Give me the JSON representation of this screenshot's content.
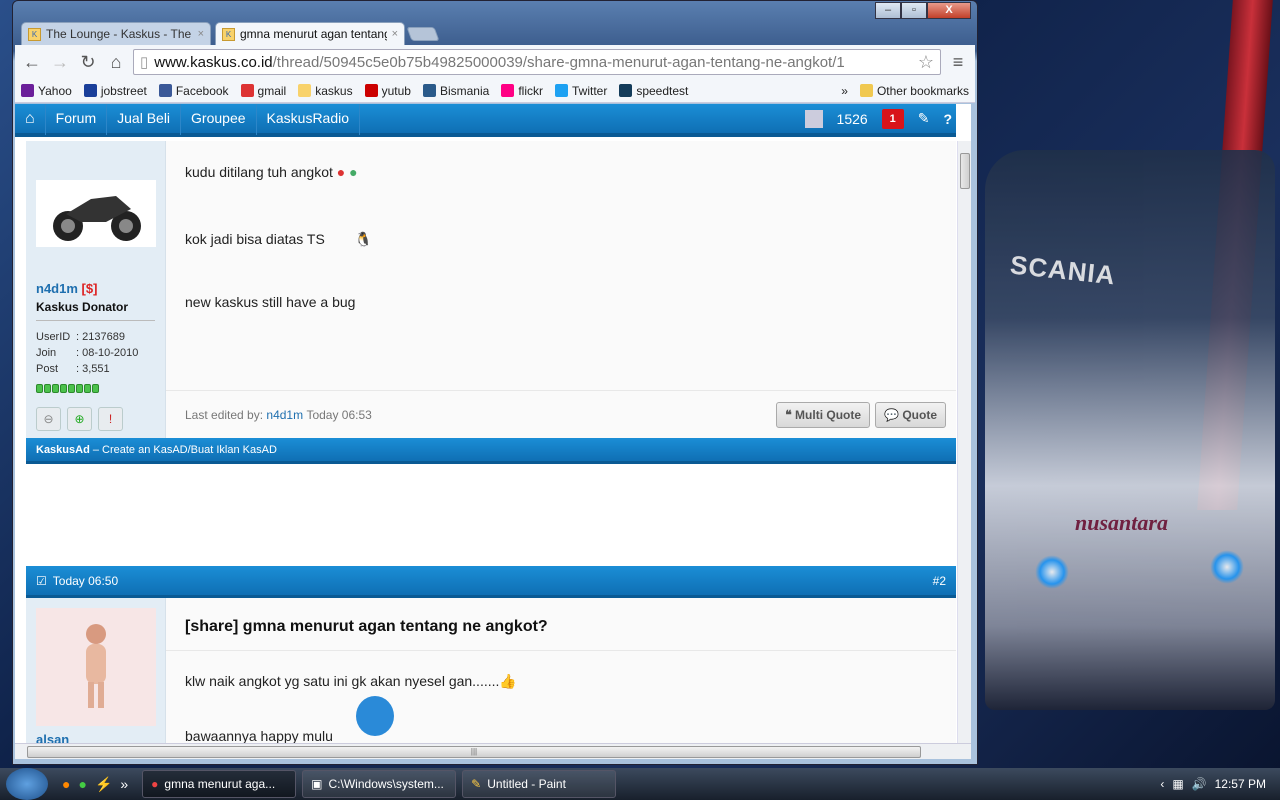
{
  "window": {
    "minimize": "–",
    "maximize": "▫",
    "close": "X"
  },
  "tabs": [
    {
      "label": "The Lounge - Kaskus - The",
      "close": "×"
    },
    {
      "label": "gmna menurut agan tentang",
      "close": "×"
    }
  ],
  "toolbar": {
    "url_domain": "www.kaskus.co.id",
    "url_path": "/thread/50945c5e0b75b49825000039/share-gmna-menurut-agan-tentang-ne-angkot/1"
  },
  "bookmarks": {
    "items": [
      {
        "label": "Yahoo",
        "color": "#6b1f9a"
      },
      {
        "label": "jobstreet",
        "color": "#1a3f9a"
      },
      {
        "label": "Facebook",
        "color": "#3b5998"
      },
      {
        "label": "gmail",
        "color": "#d33"
      },
      {
        "label": "kaskus",
        "color": "#f8d26b"
      },
      {
        "label": "yutub",
        "color": "#c00"
      },
      {
        "label": "Bismania",
        "color": "#2a5a8a"
      },
      {
        "label": "flickr",
        "color": "#ff0084"
      },
      {
        "label": "Twitter",
        "color": "#1da1f2"
      },
      {
        "label": "speedtest",
        "color": "#143c5a"
      }
    ],
    "overflow": "»",
    "other": "Other bookmarks"
  },
  "nav": {
    "items": [
      "Forum",
      "Jual Beli",
      "Groupee",
      "KaskusRadio"
    ],
    "count": "1526",
    "notif": "1",
    "help": "?"
  },
  "post1": {
    "username": "n4d1m",
    "donor_tag": "[$]",
    "user_title": "Kaskus Donator",
    "stats": [
      {
        "k": "UserID",
        "v": ": 2137689"
      },
      {
        "k": "Join",
        "v": ": 08-10-2010"
      },
      {
        "k": "Post",
        "v": ": 3,551"
      }
    ],
    "reputation_bars": 8,
    "lines": [
      "kudu ditilang tuh angkot",
      "kok jadi bisa diatas TS",
      "new kaskus still have a bug"
    ],
    "edited_label": "Last edited by:",
    "edited_user": "n4d1m",
    "edited_time": "Today 06:53",
    "multi_quote": "Multi Quote",
    "quote": "Quote"
  },
  "ad": {
    "brand": "KaskusAd",
    "text": " – Create an KasAD/Buat Iklan KasAD"
  },
  "post2": {
    "time": "Today 06:50",
    "number": "#2",
    "title": "[share] gmna menurut agan tentang ne angkot?",
    "lines": [
      "klw naik angkot yg satu ini gk akan nyesel gan.......",
      "bawaannya happy mulu"
    ],
    "username_partial": "alsan"
  },
  "taskbar": {
    "items": [
      "gmna menurut aga...",
      "C:\\Windows\\system...",
      "Untitled - Paint"
    ],
    "clock": "12:57 PM",
    "overflow": "»"
  },
  "wallpaper": {
    "brand": "SCANIA",
    "name": "nusantara"
  }
}
